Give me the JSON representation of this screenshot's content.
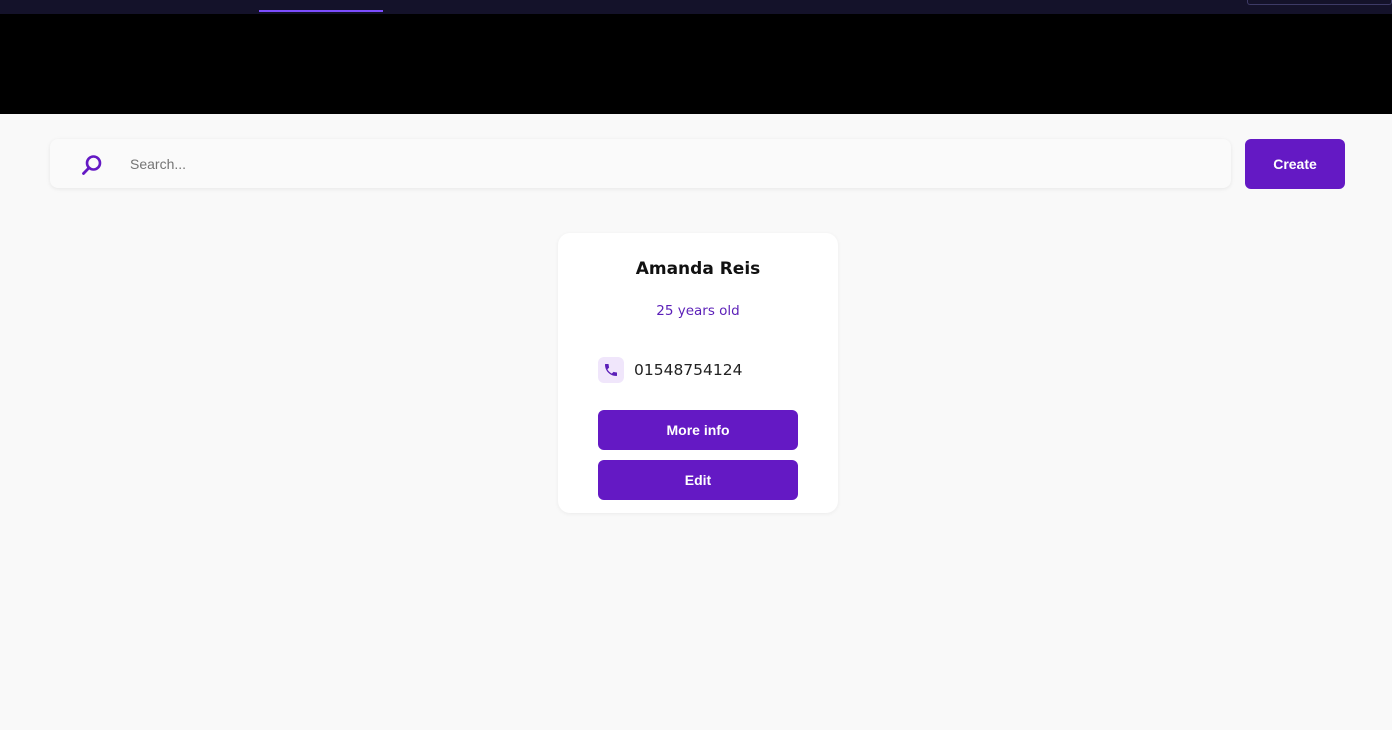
{
  "search": {
    "placeholder": "Search...",
    "value": ""
  },
  "toolbar": {
    "create_label": "Create"
  },
  "contacts": [
    {
      "name": "Amanda Reis",
      "age_text": "25 years old",
      "phone": "01548754124",
      "more_info_label": "More info",
      "edit_label": "Edit"
    }
  ],
  "icons": {
    "search": "search-icon",
    "phone": "phone-icon"
  },
  "colors": {
    "accent": "#6419c4",
    "age_text": "#5b1fb8",
    "banner": "#000000",
    "top_strip": "#14122a",
    "background": "#f9f9f9",
    "phone_icon_bg": "#f0e6fb"
  }
}
